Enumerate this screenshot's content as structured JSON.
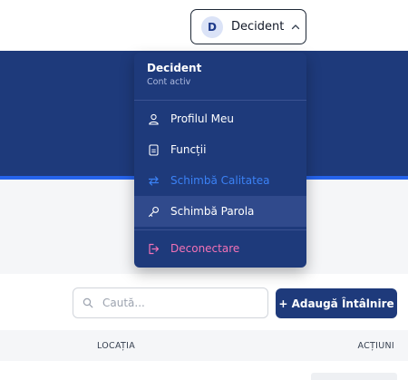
{
  "user_button": {
    "avatar_initial": "D",
    "name": "Decident"
  },
  "menu": {
    "name": "Decident",
    "status": "Cont activ",
    "items": [
      {
        "label": "Profilul Meu",
        "icon": "user-icon"
      },
      {
        "label": "Funcții",
        "icon": "document-icon"
      },
      {
        "label": "Schimbă Calitatea",
        "icon": "swap-icon"
      },
      {
        "label": "Schimbă Parola",
        "icon": "key-icon"
      },
      {
        "label": "Deconectare",
        "icon": "logout-icon"
      }
    ]
  },
  "toolbar": {
    "search_placeholder": "Caută...",
    "add_label": "+ Adaugă Întâlnire"
  },
  "table": {
    "columns": [
      "LOCAȚIA",
      "ACȚIUNI"
    ]
  },
  "colors": {
    "primary": "#1e3a7b",
    "accent": "#2563eb",
    "danger": "#f472b6",
    "disabled_item": "#3b82f6"
  }
}
